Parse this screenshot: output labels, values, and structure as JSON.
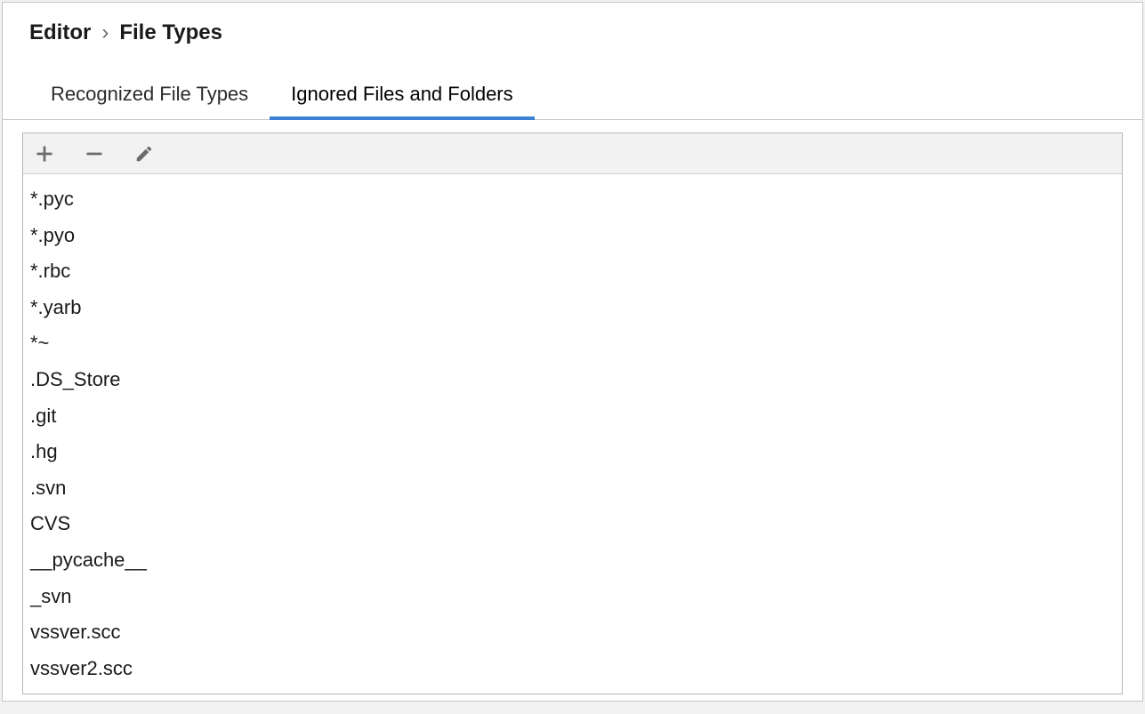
{
  "breadcrumb": {
    "parent": "Editor",
    "separator": "›",
    "current": "File Types"
  },
  "tabs": [
    {
      "label": "Recognized File Types",
      "active": false
    },
    {
      "label": "Ignored Files and Folders",
      "active": true
    }
  ],
  "toolbar": {
    "add_label": "Add",
    "remove_label": "Remove",
    "edit_label": "Edit"
  },
  "ignored_patterns": [
    "*.pyc",
    "*.pyo",
    "*.rbc",
    "*.yarb",
    "*~",
    ".DS_Store",
    ".git",
    ".hg",
    ".svn",
    "CVS",
    "__pycache__",
    "_svn",
    "vssver.scc",
    "vssver2.scc"
  ]
}
